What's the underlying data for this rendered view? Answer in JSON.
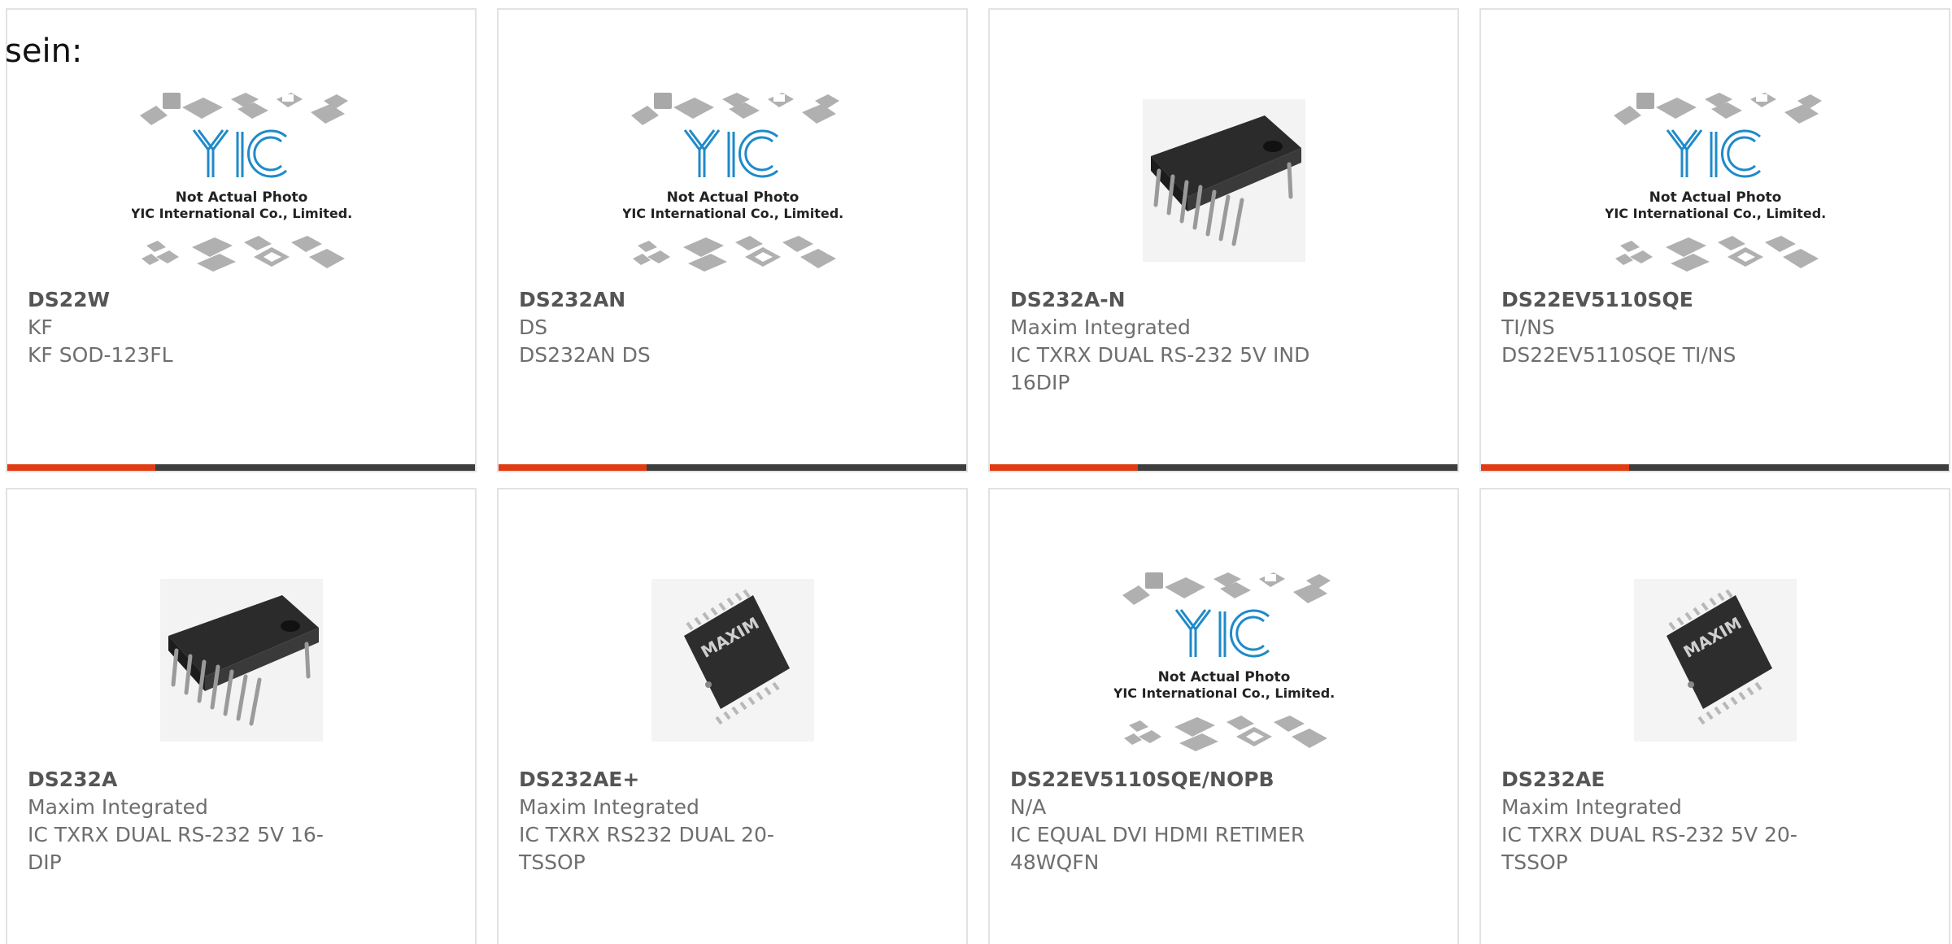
{
  "lead_text": "sein:",
  "colors": {
    "accent": "#e03b12",
    "bar": "#3d3d3d",
    "card_border": "#e2e2e2",
    "yic_blue": "#1f8ac9"
  },
  "placeholder": {
    "line1": "Not Actual Photo",
    "line2": "YIC International Co., Limited.",
    "logo_text": "YIC"
  },
  "products": [
    {
      "part": "DS22W",
      "manufacturer": "KF",
      "description": "KF SOD-123FL",
      "image": "yic-placeholder-icon"
    },
    {
      "part": "DS232AN",
      "manufacturer": "DS",
      "description": "DS232AN DS",
      "image": "yic-placeholder-icon"
    },
    {
      "part": "DS232A-N",
      "manufacturer": "Maxim Integrated",
      "description": "IC TXRX DUAL RS-232 5V IND 16DIP",
      "image": "dip-chip-icon"
    },
    {
      "part": "DS22EV5110SQE",
      "manufacturer": "TI/NS",
      "description": "DS22EV5110SQE TI/NS",
      "image": "yic-placeholder-icon"
    },
    {
      "part": "DS232A",
      "manufacturer": "Maxim Integrated",
      "description": "IC TXRX DUAL RS-232 5V 16-DIP",
      "image": "dip-chip-icon"
    },
    {
      "part": "DS232AE+",
      "manufacturer": "Maxim Integrated",
      "description": "IC TXRX RS232 DUAL 20-TSSOP",
      "image": "tssop-chip-icon",
      "chip_marking": "MAXIM"
    },
    {
      "part": "DS22EV5110SQE/NOPB",
      "manufacturer": "N/A",
      "description": "IC EQUAL DVI HDMI RETIMER 48WQFN",
      "image": "yic-placeholder-icon"
    },
    {
      "part": "DS232AE",
      "manufacturer": "Maxim Integrated",
      "description": "IC TXRX DUAL RS-232 5V 20-TSSOP",
      "image": "tssop-chip-icon",
      "chip_marking": "MAXIM"
    }
  ]
}
